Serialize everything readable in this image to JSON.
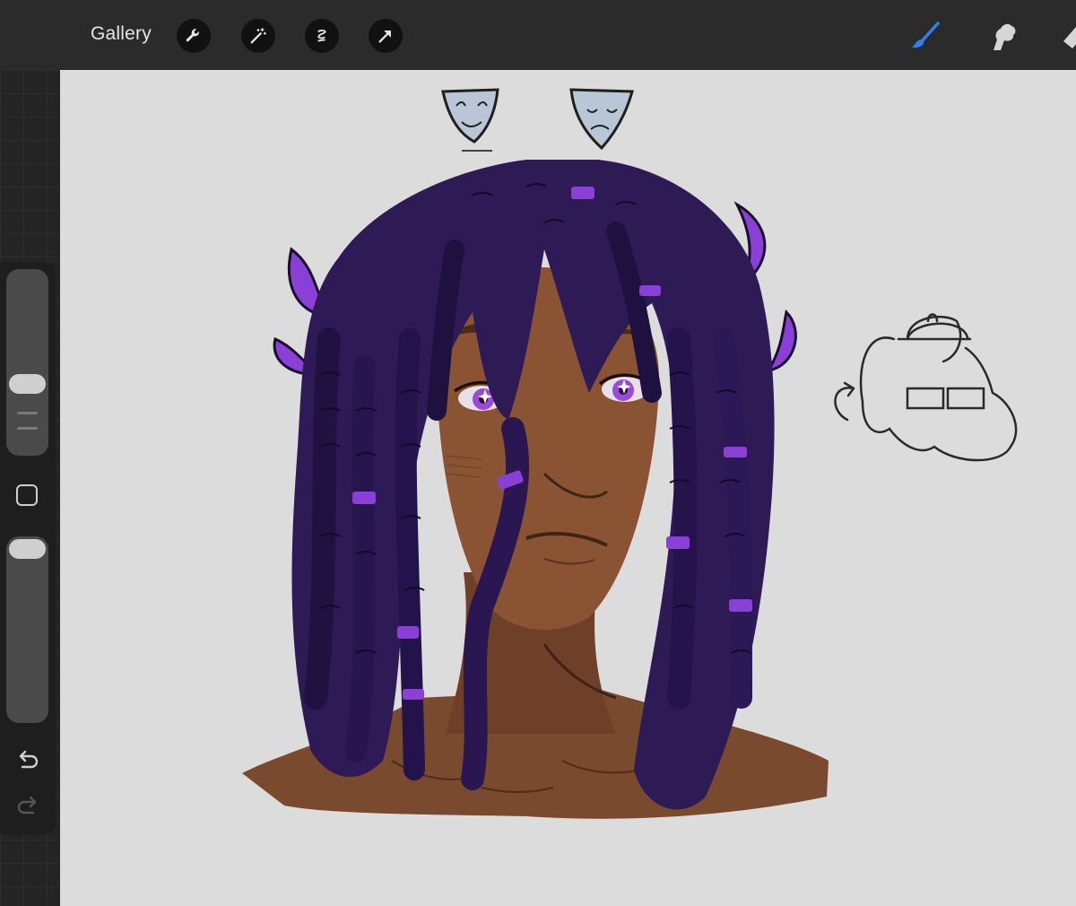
{
  "toolbar": {
    "gallery_label": "Gallery",
    "left_tools": [
      "wrench-icon",
      "magic-wand-icon",
      "selection-icon",
      "transform-arrow-icon"
    ],
    "right_tools": [
      "brush-icon",
      "smudge-icon",
      "eraser-icon"
    ],
    "active_tool": "brush-icon",
    "accent_color": "#2f7ff5"
  },
  "sidebar": {
    "size_slider_level": 0.2,
    "opacity_slider_level": 0.05
  },
  "canvas": {
    "background_color": "#dcdcdc",
    "palette": {
      "skin": "#7a4a2e",
      "hair": "#2e1a55",
      "hair_highlight": "#8a3fd6",
      "eye": "#9b4ad8",
      "mask": "#b9c6d6"
    }
  }
}
